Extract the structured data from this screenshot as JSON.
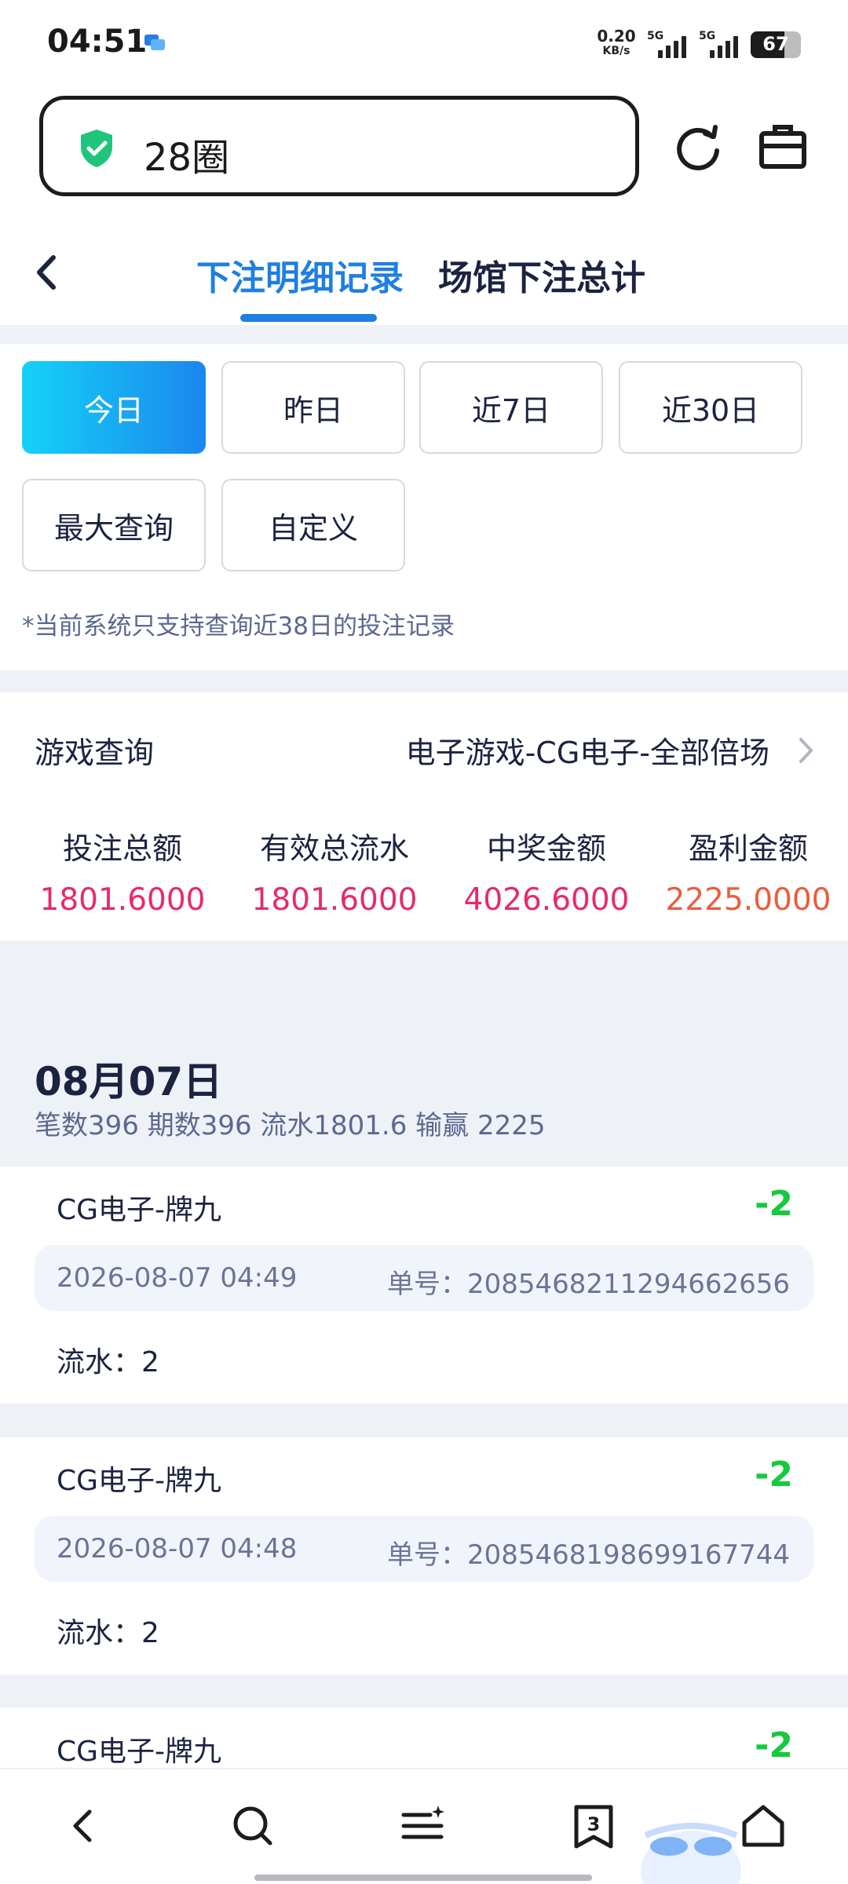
{
  "status_bar": {
    "time": "04:51",
    "net_speed_value": "0.20",
    "net_speed_unit": "KB/s",
    "sim1_label": "5G",
    "sim2_label": "5G",
    "battery_level": "67"
  },
  "browser": {
    "url_text": "28圈",
    "icons": [
      "shield-check-icon",
      "refresh-icon",
      "briefcase-icon"
    ]
  },
  "tabs": {
    "active": "下注明细记录",
    "inactive": "场馆下注总计"
  },
  "filters": {
    "chips": [
      "今日",
      "昨日",
      "近7日",
      "近30日",
      "最大查询",
      "自定义"
    ],
    "selected": "今日",
    "notice": "*当前系统只支持查询近38日的投注记录"
  },
  "game_query": {
    "label": "游戏查询",
    "value": "电子游戏-CG电子-全部倍场"
  },
  "totals": [
    {
      "label": "投注总额",
      "value": "1801.6000",
      "color": "#e8296b"
    },
    {
      "label": "有效总流水",
      "value": "1801.6000",
      "color": "#e8296b"
    },
    {
      "label": "中奖金额",
      "value": "4026.6000",
      "color": "#e8296b"
    },
    {
      "label": "盈利金额",
      "value": "2225.0000",
      "color": "#ef5a3a"
    }
  ],
  "day": {
    "title": "08月07日",
    "summary": "笔数396 期数396 流水1801.6 输赢 2225"
  },
  "records": [
    {
      "name": "CG电子-牌九",
      "amount": "-2",
      "time": "2026-08-07 04:49",
      "order": "单号：2085468211294662656",
      "flow": "流水：2"
    },
    {
      "name": "CG电子-牌九",
      "amount": "-2",
      "time": "2026-08-07 04:48",
      "order": "单号：2085468198699167744",
      "flow": "流水：2"
    },
    {
      "name": "CG电子-牌九",
      "amount": "-2",
      "time": "",
      "order": "",
      "flow": ""
    }
  ],
  "bottom_nav": {
    "tab_count": "3",
    "icons": [
      "back-icon",
      "search-icon",
      "menu-icon",
      "tabs-icon",
      "home-icon"
    ]
  }
}
